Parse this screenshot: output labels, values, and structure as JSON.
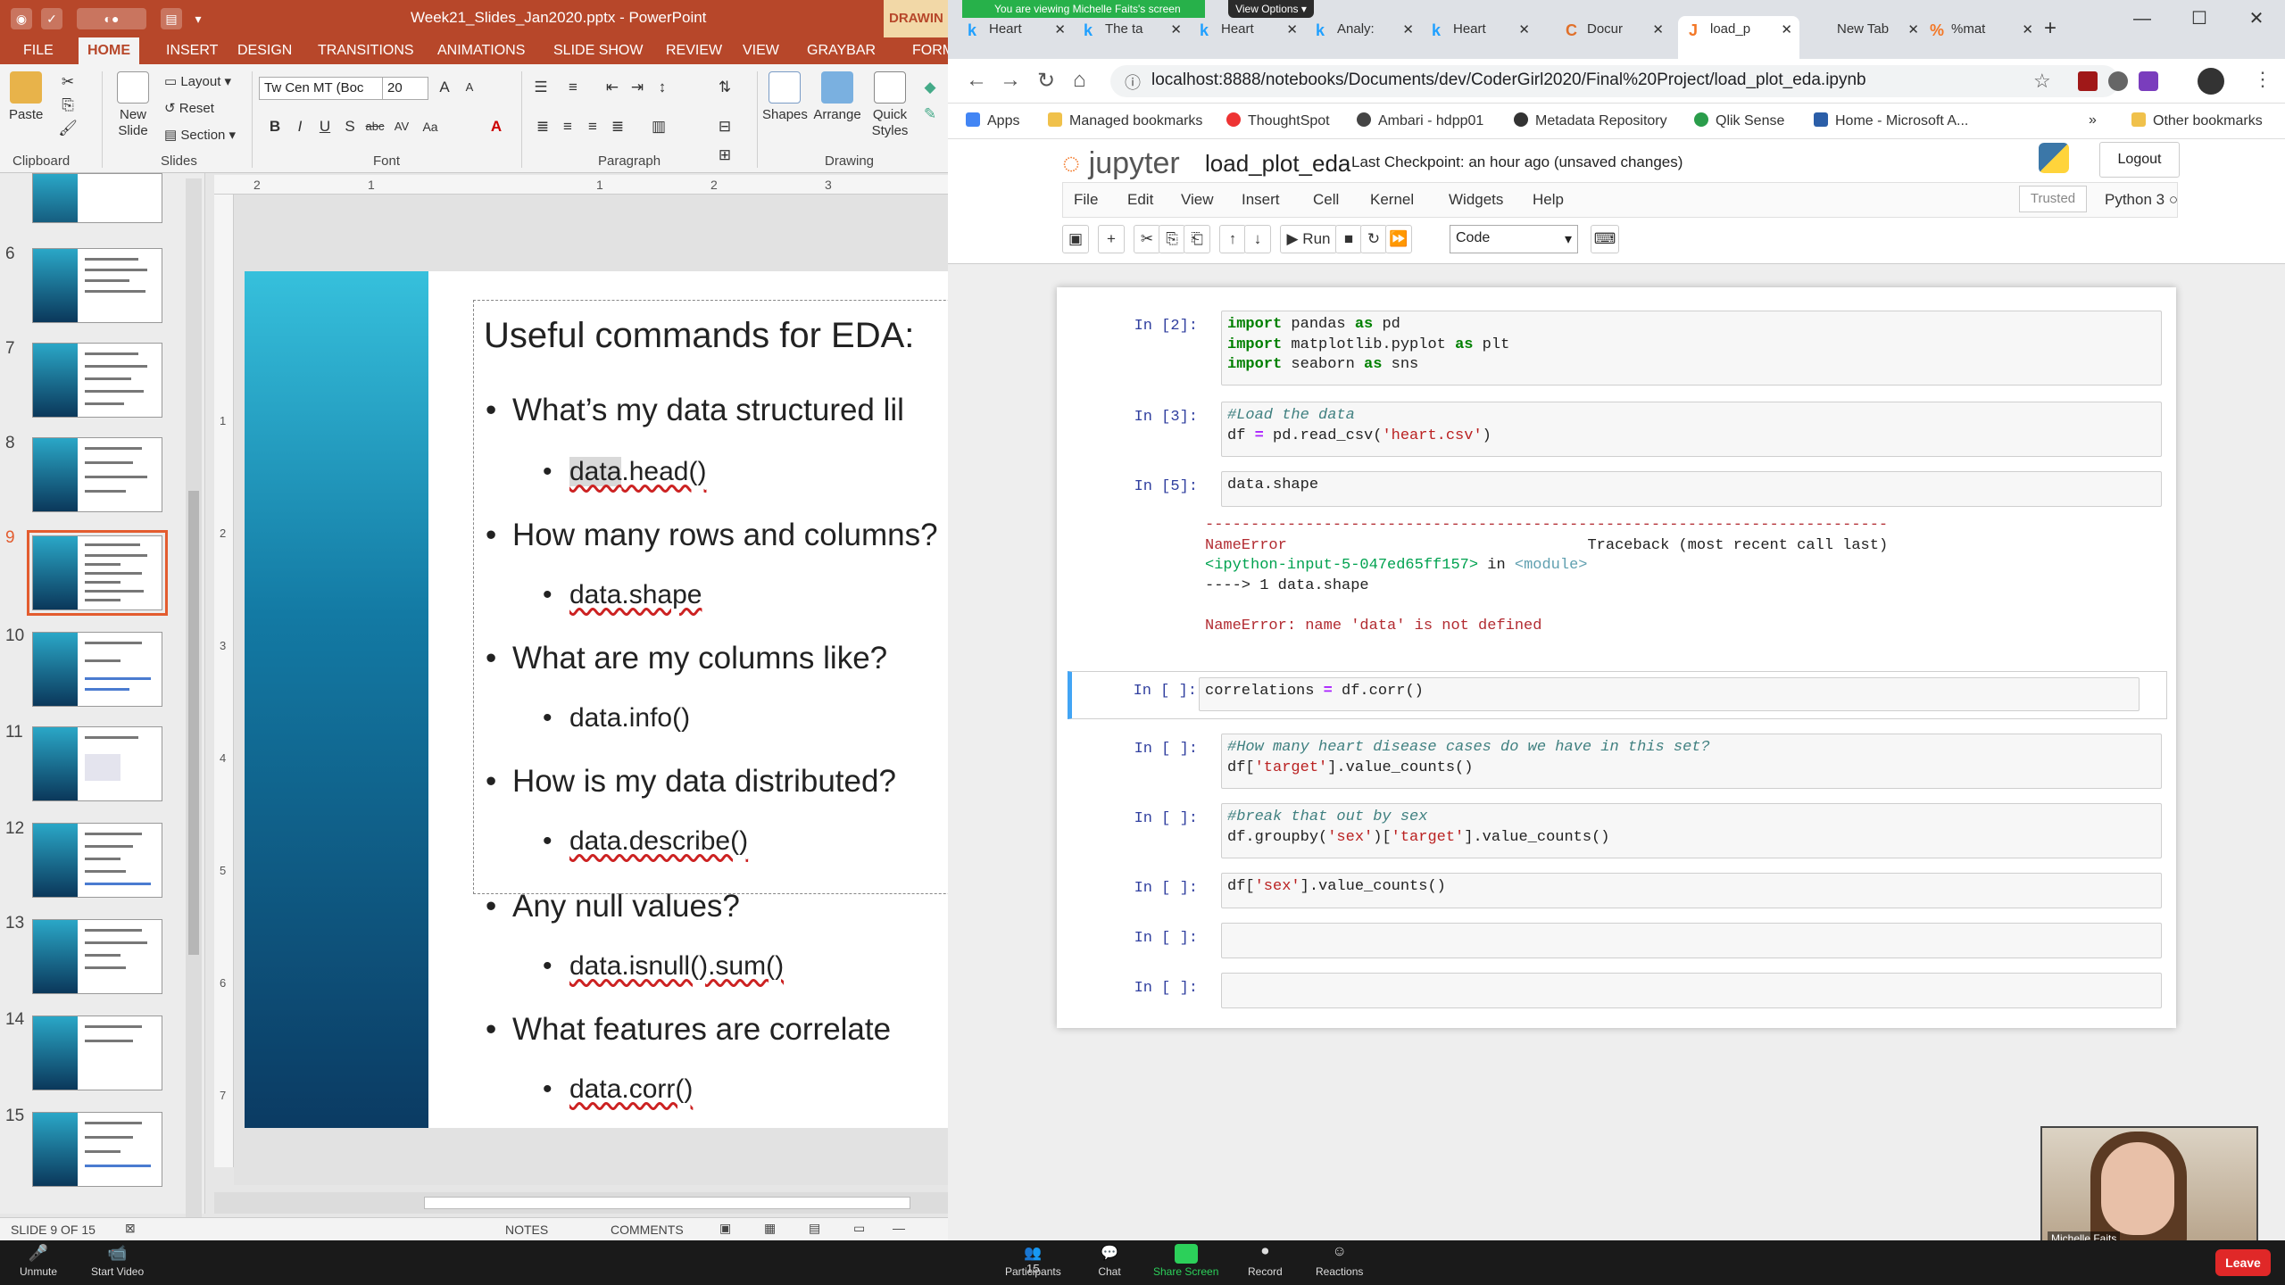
{
  "ppt": {
    "window_title": "Week21_Slides_Jan2020.pptx - PowerPoint",
    "context_tab": "DRAWIN",
    "tabs": [
      "FILE",
      "HOME",
      "INSERT",
      "DESIGN",
      "TRANSITIONS",
      "ANIMATIONS",
      "SLIDE SHOW",
      "REVIEW",
      "VIEW",
      "GRAYBAR",
      "FORM"
    ],
    "active_tab": "HOME",
    "ribbon": {
      "paste": "Paste",
      "new_slide": "New Slide",
      "layout": "Layout",
      "reset": "Reset",
      "section": "Section",
      "font_name": "Tw Cen MT (Boc",
      "font_size": "20",
      "shapes": "Shapes",
      "arrange": "Arrange",
      "quick_styles": "Quick Styles",
      "groups": [
        "Clipboard",
        "Slides",
        "Font",
        "Paragraph",
        "Drawing"
      ]
    },
    "thumb_numbers": [
      "6",
      "7",
      "8",
      "9",
      "10",
      "11",
      "12",
      "13",
      "14",
      "15"
    ],
    "selected_slide": "9",
    "slide": {
      "title": "Useful commands for EDA:",
      "bullets": [
        {
          "q": "What’s my data structured lil",
          "code": "data.head()"
        },
        {
          "q": "How many rows and columns?",
          "code": "data.shape"
        },
        {
          "q": "What are my columns like?",
          "code": "data.info()"
        },
        {
          "q": "How is my data distributed?",
          "code": "data.describe()"
        },
        {
          "q": "Any null values?",
          "code": "data.isnull().sum()"
        },
        {
          "q": "What features are correlate",
          "code": "data.corr()"
        }
      ],
      "highlight_word": "data"
    },
    "ruler_h": [
      "2",
      "1",
      "1",
      "2",
      "3"
    ],
    "ruler_v": [
      "1",
      "2",
      "3",
      "4",
      "5",
      "6",
      "7"
    ],
    "status": {
      "slide": "SLIDE 9 OF 15",
      "notes": "NOTES",
      "comments": "COMMENTS"
    }
  },
  "chrome": {
    "share_banner": "You are viewing Michelle Faits's screen",
    "view_options": "View Options",
    "tabs": [
      {
        "label": "Heart",
        "icon": "k"
      },
      {
        "label": "The ta",
        "icon": "k"
      },
      {
        "label": "Heart",
        "icon": "k"
      },
      {
        "label": "Analy:",
        "icon": "k"
      },
      {
        "label": "Heart",
        "icon": "k"
      },
      {
        "label": "Docur",
        "icon": "C"
      },
      {
        "label": "load_p",
        "icon": "J"
      },
      {
        "label": "New Tab",
        "icon": ""
      },
      {
        "label": "%mat",
        "icon": "%"
      }
    ],
    "url": "localhost:8888/notebooks/Documents/dev/CoderGirl2020/Final%20Project/load_plot_eda.ipynb",
    "bookmarks": [
      "Apps",
      "Managed bookmarks",
      "ThoughtSpot",
      "Ambari - hdpp01",
      "Metadata Repository",
      "Qlik Sense",
      "Home - Microsoft A...",
      "Other bookmarks"
    ]
  },
  "jupyter": {
    "logo": "jupyter",
    "notebook_name": "load_plot_eda",
    "checkpoint": "Last Checkpoint: an hour ago  (unsaved changes)",
    "logout": "Logout",
    "menu": [
      "File",
      "Edit",
      "View",
      "Insert",
      "Cell",
      "Kernel",
      "Widgets",
      "Help"
    ],
    "trusted": "Trusted",
    "kernel": "Python 3",
    "run": "Run",
    "cell_type": "Code",
    "cells": [
      {
        "prompt": "In [2]:",
        "code": "import pandas as pd\nimport matplotlib.pyplot as plt\nimport seaborn as sns"
      },
      {
        "prompt": "In [3]:",
        "code": "#Load the data\ndf = pd.read_csv('heart.csv')"
      },
      {
        "prompt": "In [5]:",
        "code": "data.shape"
      },
      {
        "prompt": "In [ ]:",
        "code": "correlations = df.corr()"
      },
      {
        "prompt": "In [ ]:",
        "code": "#How many heart disease cases do we have in this set?\ndf['target'].value_counts()"
      },
      {
        "prompt": "In [ ]:",
        "code": "#break that out by sex\ndf.groupby('sex')['target'].value_counts()"
      },
      {
        "prompt": "In [ ]:",
        "code": "df['sex'].value_counts()"
      },
      {
        "prompt": "In [ ]:",
        "code": ""
      },
      {
        "prompt": "In [ ]:",
        "code": ""
      }
    ],
    "error": {
      "dashes": "---------------------------------------------------------------------------",
      "name": "NameError",
      "traceback": "Traceback (most recent call last)",
      "input_ref": "<ipython-input-5-047ed65ff157>",
      "in": " in ",
      "module": "<module>",
      "arrow_line": "----> 1 data.shape",
      "message": "NameError: name 'data' is not defined"
    }
  },
  "zoom": {
    "buttons": [
      "Unmute",
      "Start Video",
      "Participants",
      "Chat",
      "Share Screen",
      "Record",
      "Reactions"
    ],
    "participants_count": "15",
    "leave": "Leave",
    "webcam_name": "Michelle Faits"
  }
}
